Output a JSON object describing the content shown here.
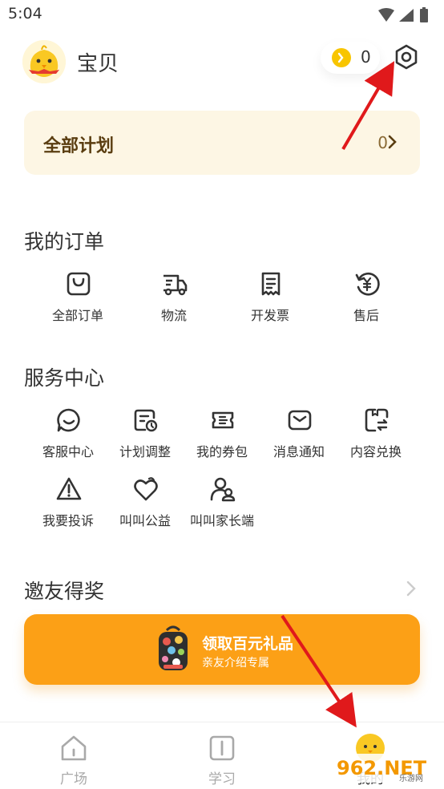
{
  "status_bar": {
    "time": "5:04"
  },
  "profile": {
    "name": "宝贝",
    "coins": "0"
  },
  "plan": {
    "title": "全部计划",
    "count": "0"
  },
  "orders": {
    "title": "我的订单",
    "items": [
      {
        "label": "全部订单",
        "icon": "shopping-bag-icon"
      },
      {
        "label": "物流",
        "icon": "truck-icon"
      },
      {
        "label": "开发票",
        "icon": "receipt-icon"
      },
      {
        "label": "售后",
        "icon": "yuan-refresh-icon"
      }
    ]
  },
  "services": {
    "title": "服务中心",
    "items": [
      {
        "label": "客服中心",
        "icon": "chat-bubble-icon"
      },
      {
        "label": "计划调整",
        "icon": "plan-clock-icon"
      },
      {
        "label": "我的券包",
        "icon": "ticket-icon"
      },
      {
        "label": "消息通知",
        "icon": "envelope-icon"
      },
      {
        "label": "内容兑换",
        "icon": "exchange-icon"
      },
      {
        "label": "我要投诉",
        "icon": "warning-icon"
      },
      {
        "label": "叫叫公益",
        "icon": "heart-charity-icon"
      },
      {
        "label": "叫叫家长端",
        "icon": "parent-users-icon"
      }
    ]
  },
  "invite": {
    "title": "邀友得奖",
    "banner_title": "领取百元礼品",
    "banner_subtitle": "亲友介绍专属"
  },
  "tabbar": {
    "items": [
      {
        "label": "广场",
        "icon": "house-icon"
      },
      {
        "label": "学习",
        "icon": "book-icon"
      },
      {
        "label": "我的",
        "icon": "chick-avatar-icon"
      }
    ]
  },
  "watermark": {
    "text": "962.NET",
    "sub": "乐游网"
  },
  "colors": {
    "accent": "#fca016",
    "plan_bg": "#fdf6e4",
    "plan_text": "#5a3d10",
    "annotation_arrow": "#e0191b",
    "coin": "#f8c500"
  }
}
